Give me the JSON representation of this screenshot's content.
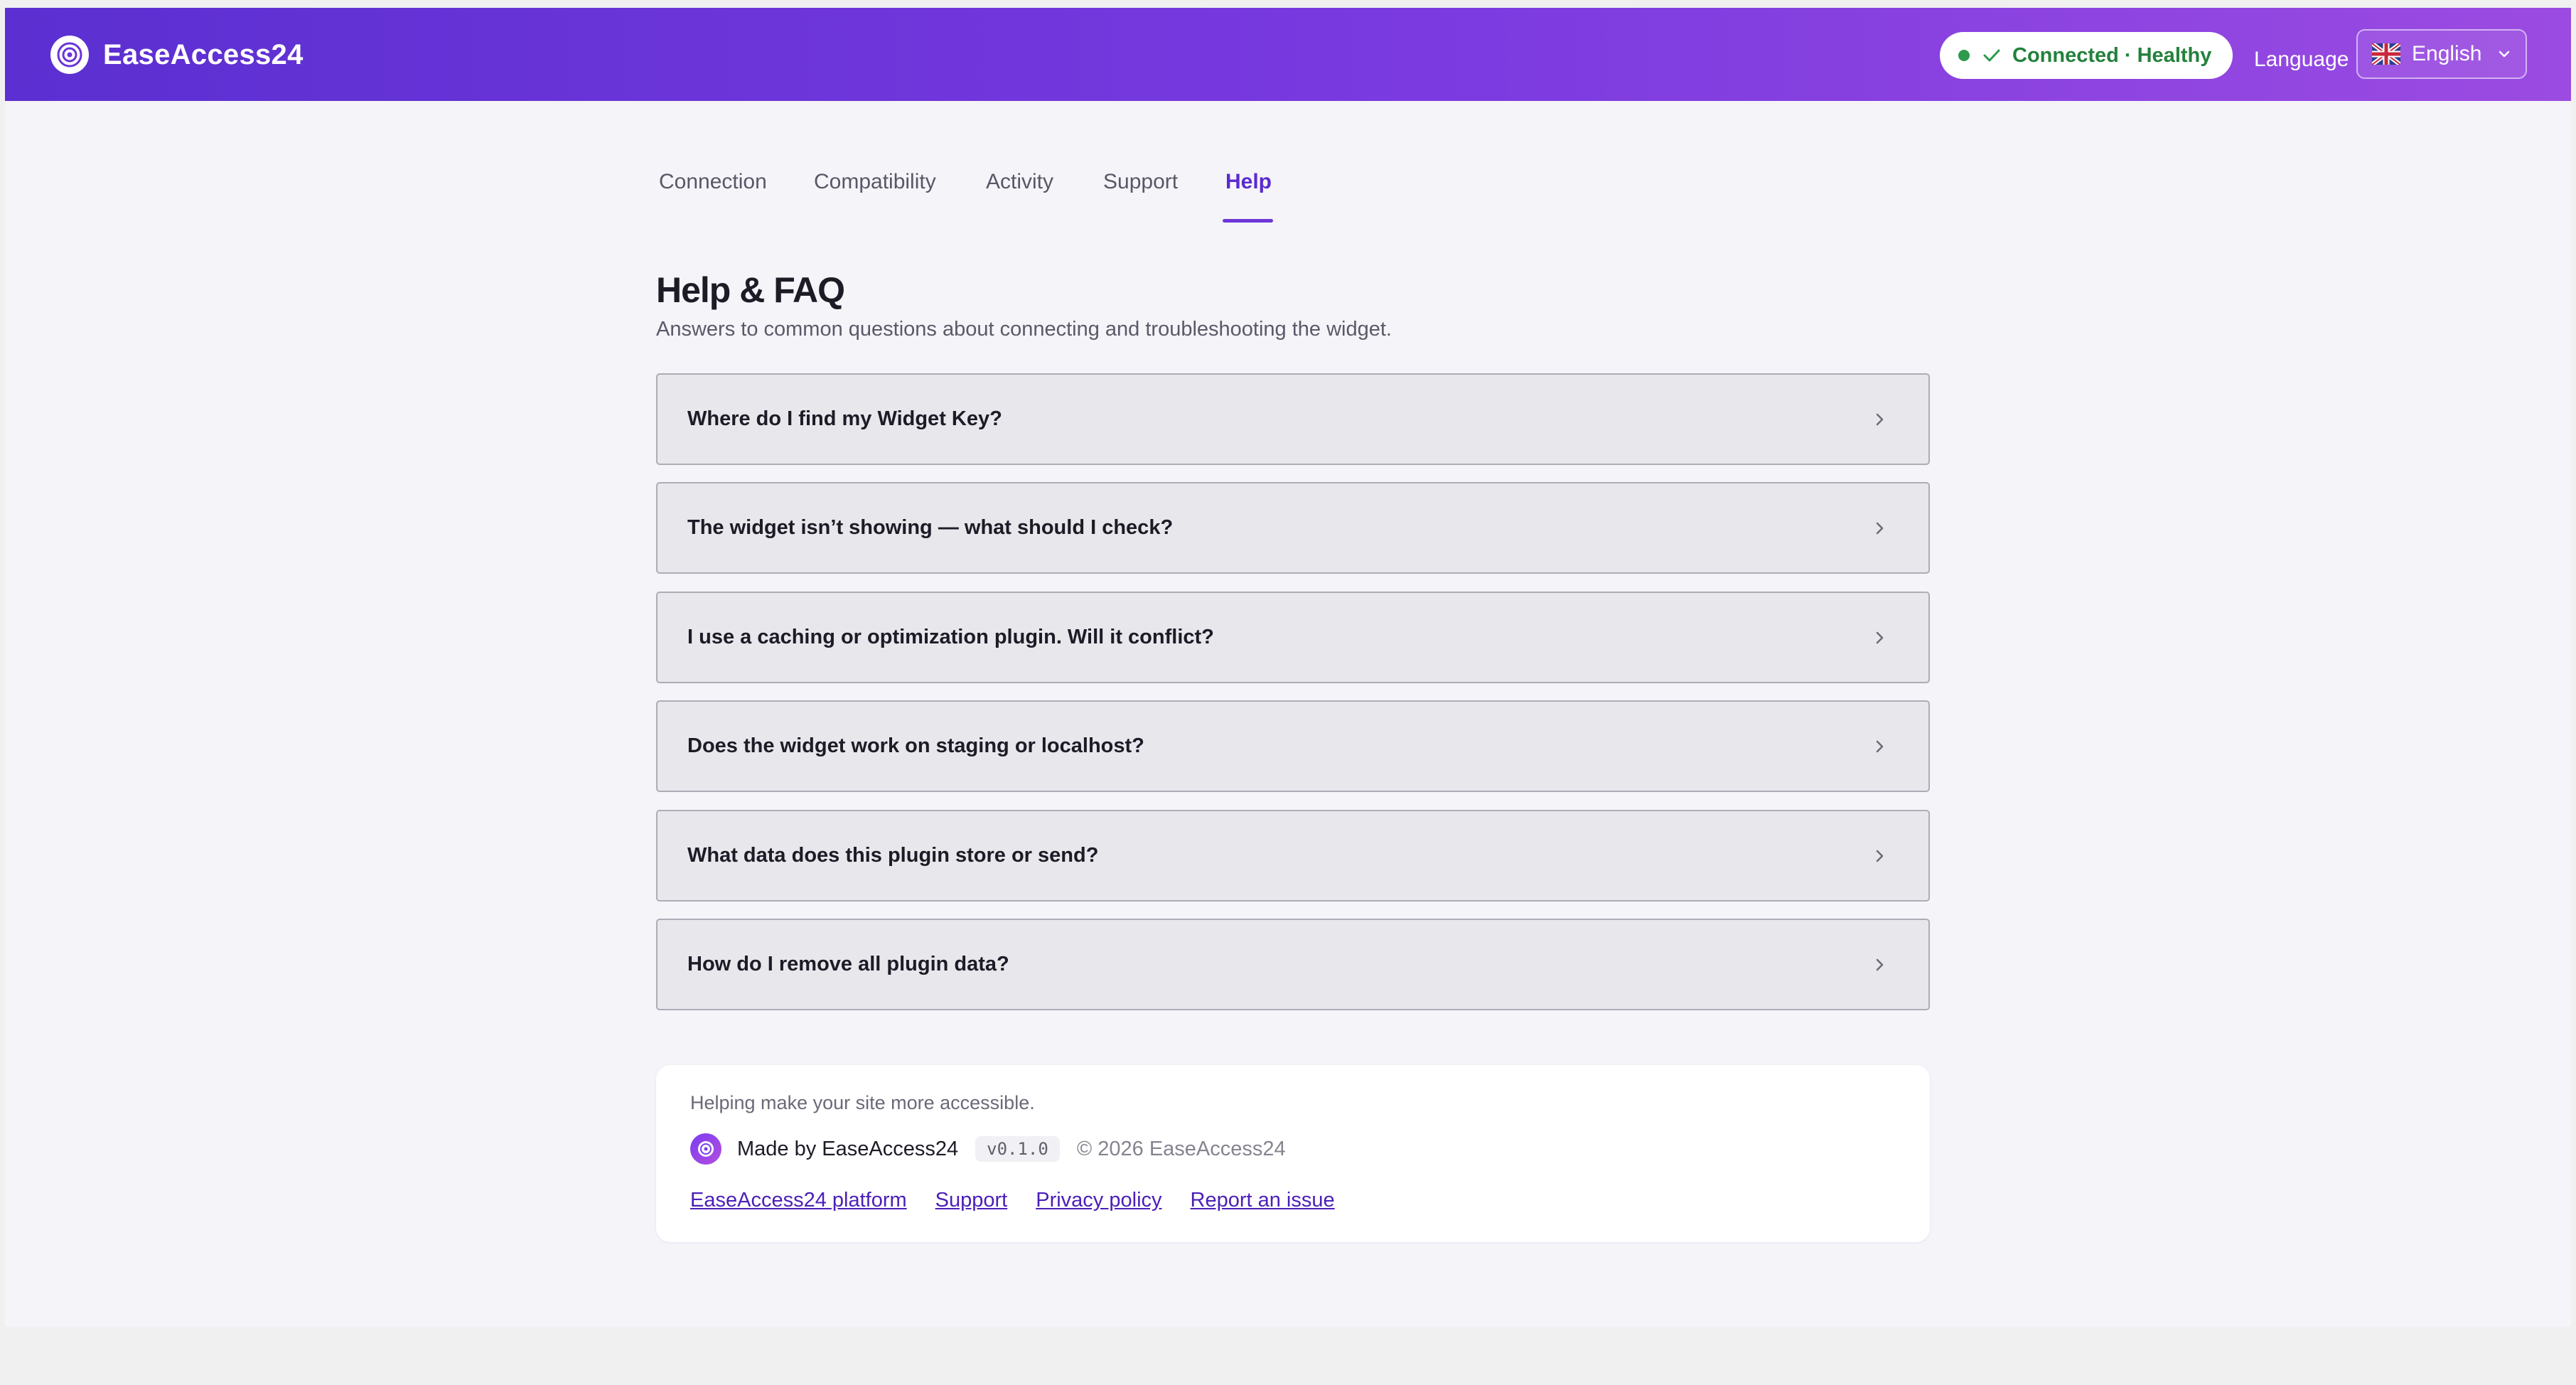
{
  "app": {
    "name": "EaseAccess24"
  },
  "header": {
    "status_text": "Connected · Healthy",
    "language_label": "Language",
    "language_value": "English"
  },
  "tabs": [
    {
      "label": "Connection",
      "active": false
    },
    {
      "label": "Compatibility",
      "active": false
    },
    {
      "label": "Activity",
      "active": false
    },
    {
      "label": "Support",
      "active": false
    },
    {
      "label": "Help",
      "active": true
    }
  ],
  "page": {
    "title": "Help & FAQ",
    "subtitle": "Answers to common questions about connecting and troubleshooting the widget."
  },
  "faq": [
    {
      "question": "Where do I find my Widget Key?"
    },
    {
      "question": "The widget isn’t showing — what should I check?"
    },
    {
      "question": "I use a caching or optimization plugin. Will it conflict?"
    },
    {
      "question": "Does the widget work on staging or localhost?"
    },
    {
      "question": "What data does this plugin store or send?"
    },
    {
      "question": "How do I remove all plugin data?"
    }
  ],
  "footer": {
    "tagline": "Helping make your site more accessible.",
    "made_by": "Made by EaseAccess24",
    "version": "v0.1.0",
    "copyright": "© 2026 EaseAccess24",
    "links": [
      {
        "label": "EaseAccess24 platform"
      },
      {
        "label": "Support"
      },
      {
        "label": "Privacy policy"
      },
      {
        "label": "Report an issue"
      }
    ]
  },
  "icons": {
    "brand": "eye-logo-icon",
    "status_dot": "status-dot-icon",
    "status_check": "check-icon",
    "language_flag": "uk-flag-icon",
    "language_chevron": "chevron-down-icon",
    "faq_chevron": "chevron-right-icon"
  },
  "colors": {
    "header_gradient_start": "#5b2fd1",
    "header_gradient_end": "#9b4be1",
    "accent": "#5b2bcd",
    "status_green": "#23813c",
    "link": "#4b1fb8"
  }
}
